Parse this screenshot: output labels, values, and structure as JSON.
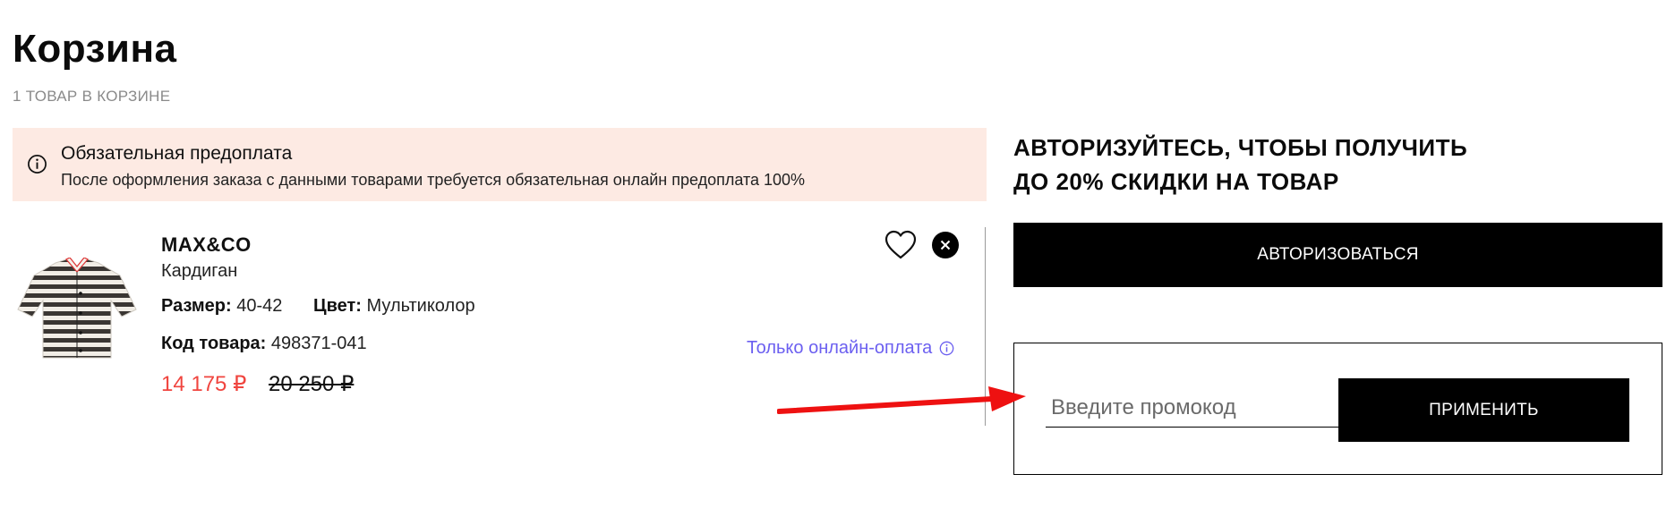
{
  "header": {
    "title": "Корзина",
    "count": "1 ТОВАР В КОРЗИНЕ"
  },
  "notice": {
    "title": "Обязательная предоплата",
    "text": "После оформления заказа с данными товарами требуется обязательная онлайн предоплата 100%",
    "icon": "info-icon",
    "background": "#fdeae3"
  },
  "product": {
    "brand": "MAX&CO",
    "type": "Кардиган",
    "size_label": "Размер:",
    "size_value": "40-42",
    "color_label": "Цвет:",
    "color_value": "Мультиколор",
    "code_label": "Код товара:",
    "code_value": "498371-041",
    "price": "14 175 ₽",
    "old_price": "20 250 ₽",
    "online_only": "Только онлайн-оплата",
    "price_color": "#f0453f",
    "link_color": "#6b5ff0"
  },
  "auth": {
    "heading_line1": "АВТОРИЗУЙТЕСЬ, ЧТОБЫ ПОЛУЧИТЬ",
    "heading_line2": "ДО 20% СКИДКИ НА ТОВАР",
    "button": "АВТОРИЗОВАТЬСЯ"
  },
  "promo": {
    "placeholder": "Введите промокод",
    "value": "",
    "apply_button": "ПРИМЕНИТЬ"
  },
  "annotation": {
    "arrow_color": "#ee1111"
  }
}
